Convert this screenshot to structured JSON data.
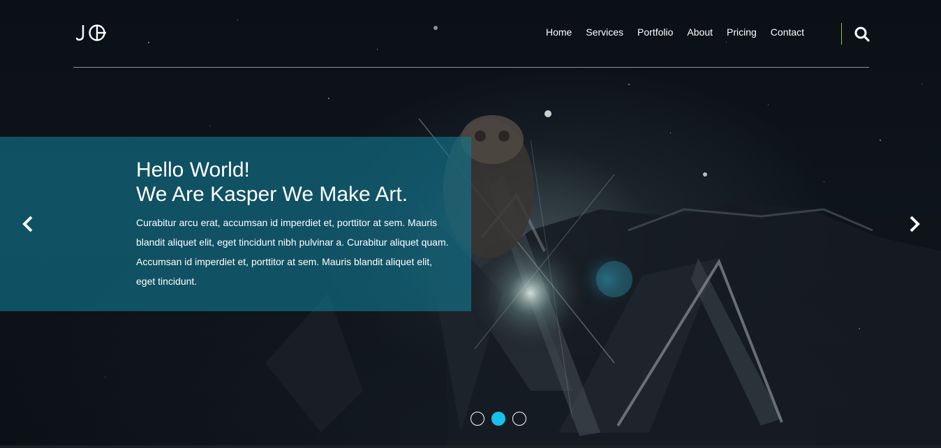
{
  "header": {
    "logo_text": "J",
    "nav": [
      "Home",
      "Services",
      "Portfolio",
      "About",
      "Pricing",
      "Contact"
    ],
    "search_icon": "search-icon",
    "divider_color": "#8bc34a"
  },
  "slider": {
    "title_line1": "Hello World!",
    "title_line2": "We Are Kasper We Make Art.",
    "text": "Curabitur arcu erat, accumsan id imperdiet et, porttitor at sem. Mauris blandit aliquet elit, eget tincidunt nibh pulvinar a. Curabitur aliquet quam. Accumsan id imperdiet et, porttitor at sem. Mauris blandit aliquet elit, eget tincidunt.",
    "prev_icon": "chevron-left-icon",
    "next_icon": "chevron-right-icon",
    "dots": 3,
    "active_dot": 2,
    "panel_color": "#127891",
    "active_dot_color": "#19c1ea"
  }
}
